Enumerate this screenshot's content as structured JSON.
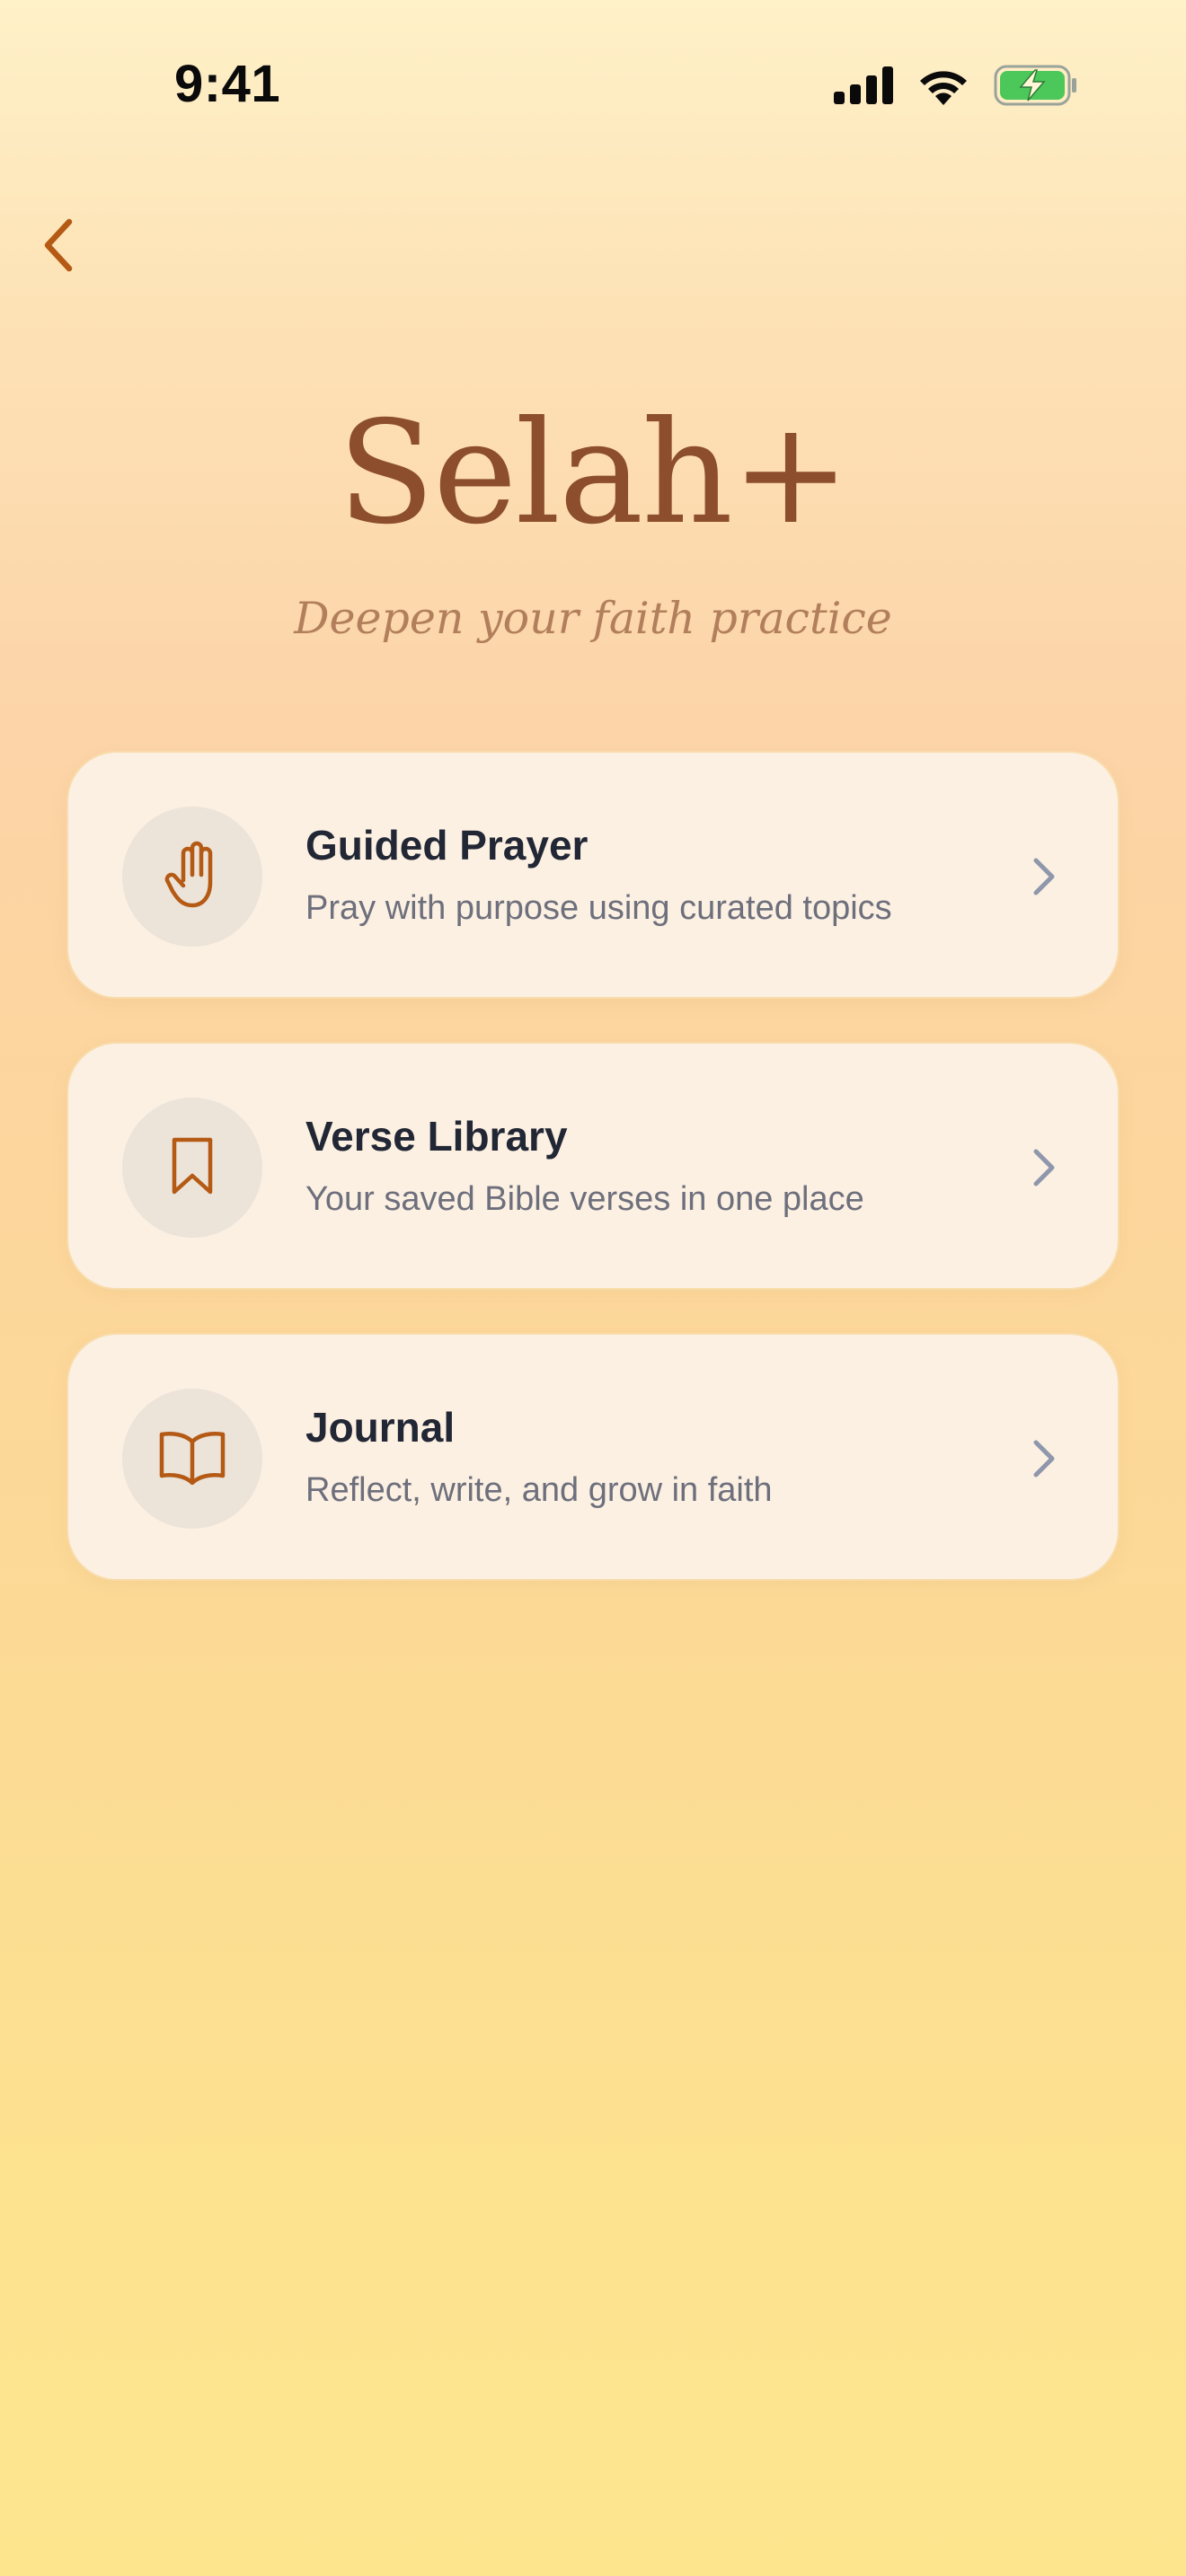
{
  "status_bar": {
    "time": "9:41",
    "icons": [
      "cellular-signal-icon",
      "wifi-icon",
      "battery-charging-icon"
    ]
  },
  "nav": {
    "back_icon": "chevron-left-icon"
  },
  "header": {
    "title": "Selah+",
    "subtitle": "Deepen your faith practice"
  },
  "menu": {
    "items": [
      {
        "icon": "hand-icon",
        "title": "Guided Prayer",
        "description": "Pray with purpose using curated topics"
      },
      {
        "icon": "bookmark-icon",
        "title": "Verse Library",
        "description": "Your saved Bible verses in one place"
      },
      {
        "icon": "open-book-icon",
        "title": "Journal",
        "description": "Reflect, write, and grow in faith"
      }
    ]
  },
  "colors": {
    "accent": "#b45a14",
    "title": "#8c4e2c",
    "chevron": "#8e97ab",
    "battery_fill": "#4cc75a"
  }
}
